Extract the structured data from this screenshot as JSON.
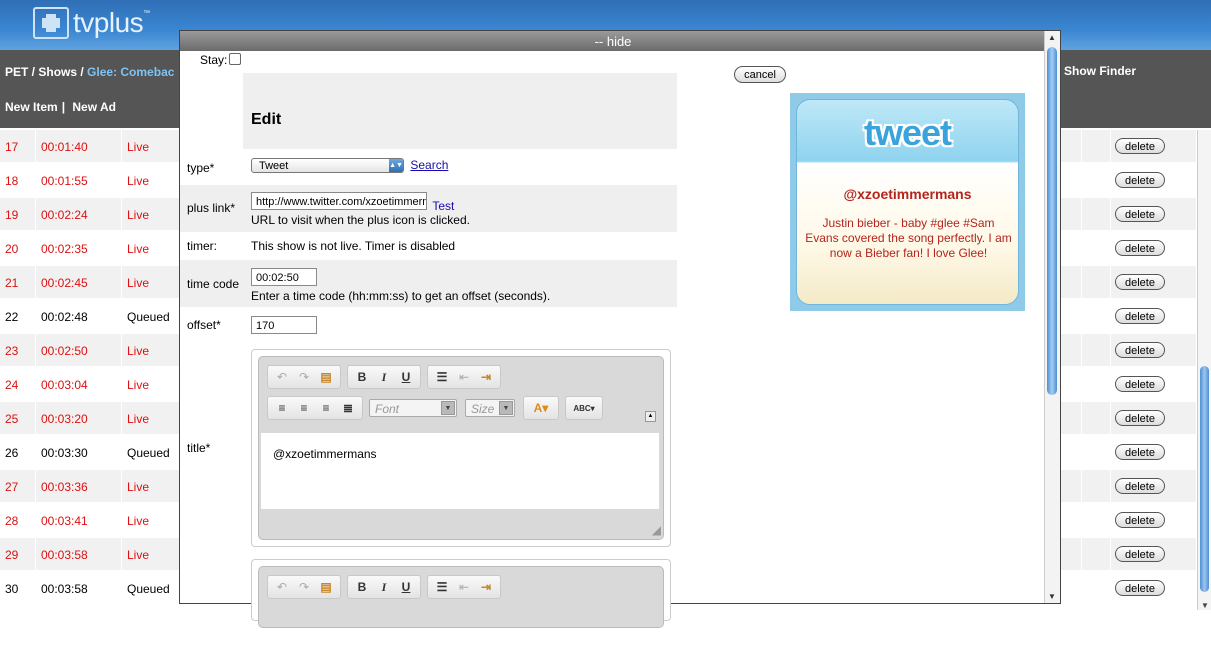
{
  "app": {
    "logo_text": "tvplus",
    "logo_tm": "™"
  },
  "nav": {
    "crumb_1": "PET",
    "crumb_sep": " / ",
    "crumb_2": "Shows",
    "crumb_3": "Glee: Comebac",
    "new_item": "New Item",
    "new_ad": "New Ad",
    "show_finder": "Show Finder"
  },
  "table": {
    "delete_label": "delete",
    "rows": [
      {
        "num": "17",
        "time": "00:01:40",
        "status": "Live"
      },
      {
        "num": "18",
        "time": "00:01:55",
        "status": "Live"
      },
      {
        "num": "19",
        "time": "00:02:24",
        "status": "Live"
      },
      {
        "num": "20",
        "time": "00:02:35",
        "status": "Live"
      },
      {
        "num": "21",
        "time": "00:02:45",
        "status": "Live"
      },
      {
        "num": "22",
        "time": "00:02:48",
        "status": "Queued"
      },
      {
        "num": "23",
        "time": "00:02:50",
        "status": "Live"
      },
      {
        "num": "24",
        "time": "00:03:04",
        "status": "Live"
      },
      {
        "num": "25",
        "time": "00:03:20",
        "status": "Live"
      },
      {
        "num": "26",
        "time": "00:03:30",
        "status": "Queued"
      },
      {
        "num": "27",
        "time": "00:03:36",
        "status": "Live"
      },
      {
        "num": "28",
        "time": "00:03:41",
        "status": "Live"
      },
      {
        "num": "29",
        "time": "00:03:58",
        "status": "Live"
      },
      {
        "num": "30",
        "time": "00:03:58",
        "status": "Queued"
      }
    ]
  },
  "modal": {
    "hide_label": "-- hide",
    "stay_label": "Stay:",
    "cancel_label": "cancel",
    "edit_heading": "Edit",
    "type_label": "type*",
    "type_value": "Tweet",
    "search_link": "Search",
    "plus_link_label": "plus link*",
    "plus_link_value": "http://www.twitter.com/xzoetimmermans",
    "test_link": "Test",
    "plus_link_help": "URL to visit when the plus icon is clicked.",
    "timer_label": "timer:",
    "timer_text": "This show is not live. Timer is disabled",
    "timecode_label": "time code",
    "timecode_value": "00:02:50",
    "timecode_help": "Enter a time code (hh:mm:ss) to get an offset (seconds).",
    "offset_label": "offset*",
    "offset_value": "170",
    "title_label": "title*",
    "title_value": "@xzoetimmermans",
    "font_placeholder": "Font",
    "size_placeholder": "Size"
  },
  "tweet": {
    "logo": "tweet",
    "user": "@xzoetimmermans",
    "text": "Justin bieber - baby #glee #Sam Evans covered the song perfectly. I am now a Bieber fan! I love Glee!"
  },
  "colors": {
    "live": "#dd1111",
    "header_blue": "#3b86d2",
    "nav_grey": "#555555",
    "tweet_red": "#b3251e"
  }
}
